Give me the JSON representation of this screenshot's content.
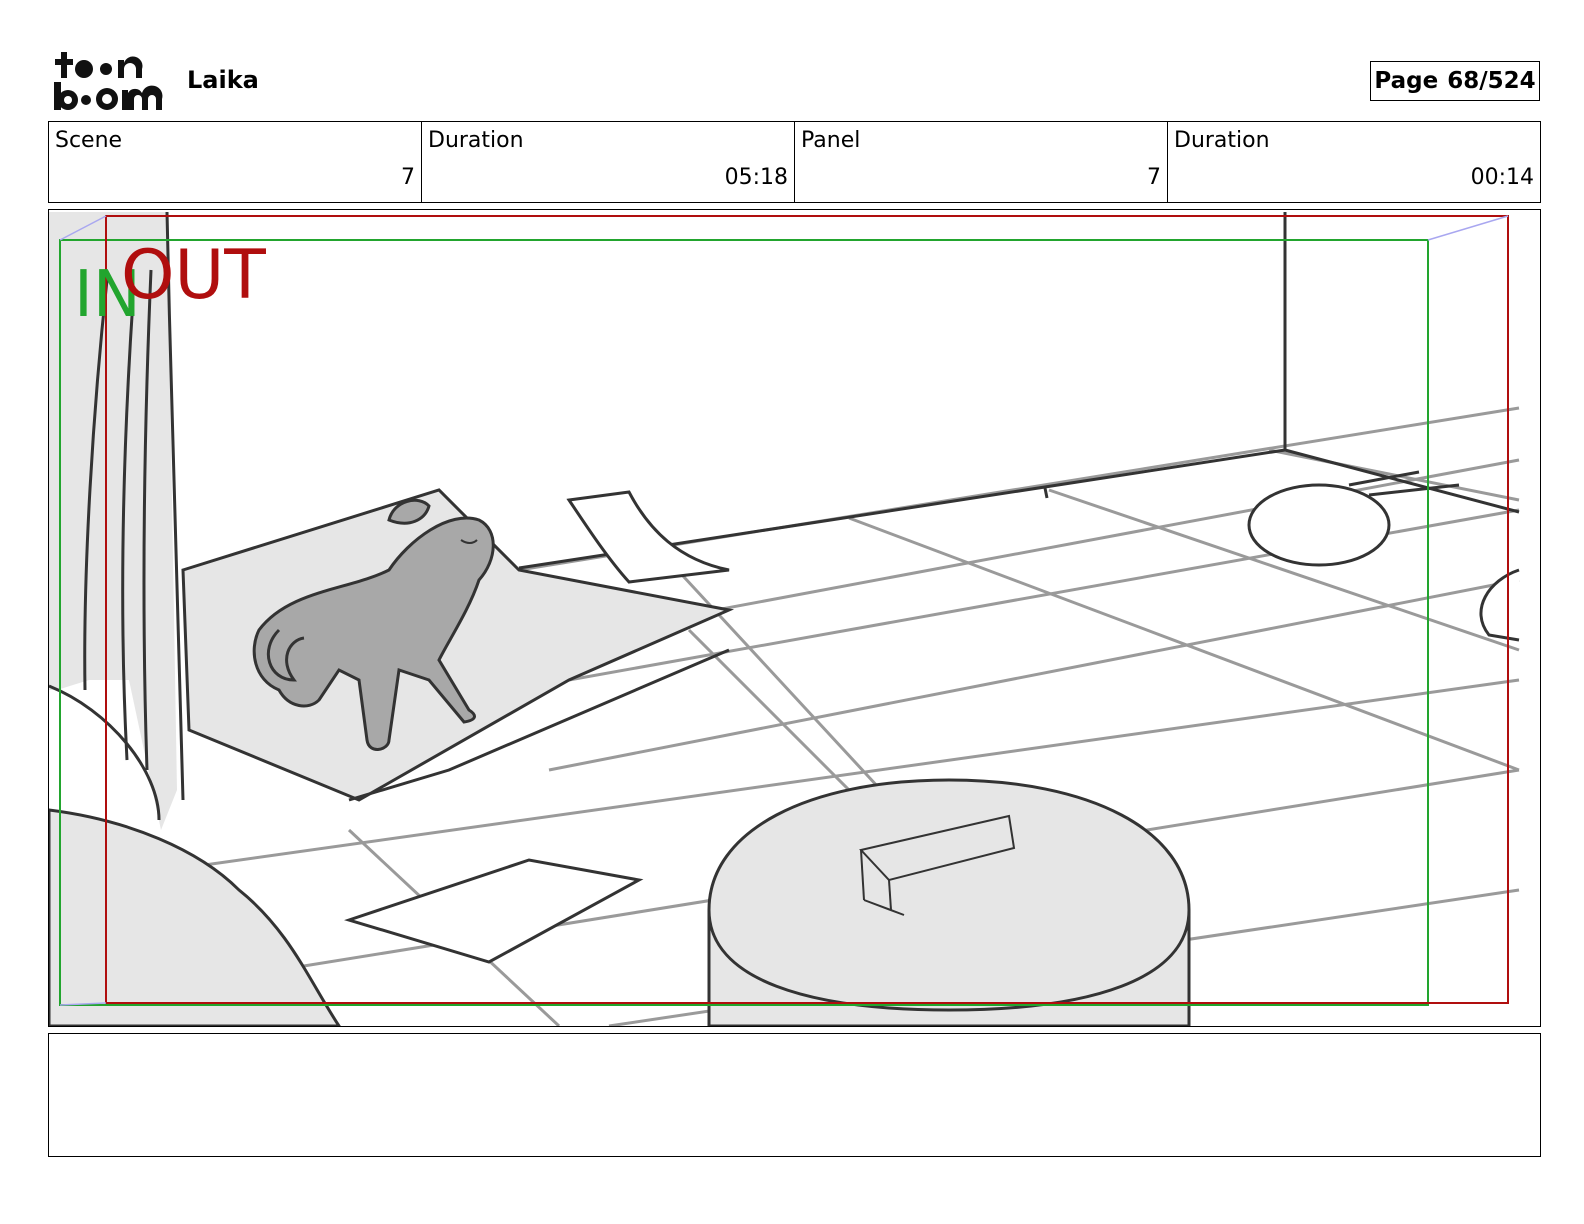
{
  "header": {
    "logo_alt": "toon boom",
    "project_title": "Laika",
    "page_label": "Page",
    "page_number": "68/524"
  },
  "info": [
    {
      "label": "Scene",
      "value": "7"
    },
    {
      "label": "Duration",
      "value": "05:18"
    },
    {
      "label": "Panel",
      "value": "7"
    },
    {
      "label": "Duration",
      "value": "00:14"
    }
  ],
  "frame": {
    "in_label": "IN",
    "out_label": "OUT",
    "in_color": "#22a52e",
    "out_color": "#b00e0e"
  },
  "notes": {
    "text": ""
  }
}
